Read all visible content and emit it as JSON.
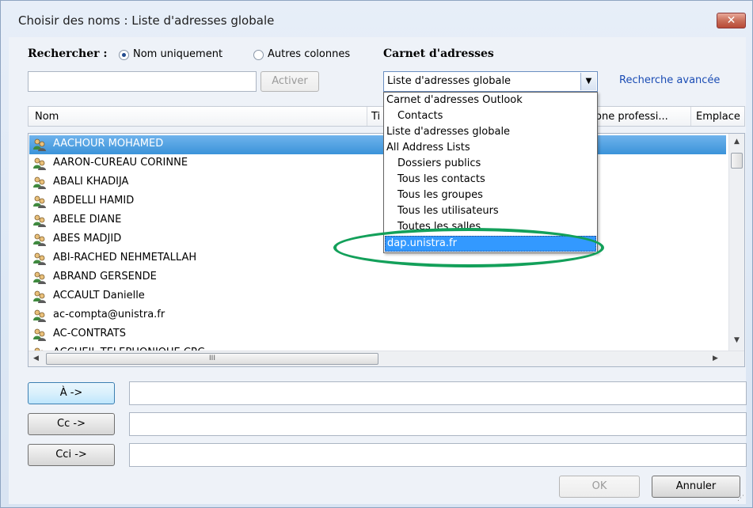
{
  "window": {
    "title": "Choisir des noms : Liste d'adresses globale",
    "close_glyph": "✕"
  },
  "search": {
    "label": "Rechercher :",
    "option_name_only": "Nom uniquement",
    "option_other_columns": "Autres colonnes",
    "selected_option": "Nom uniquement",
    "query_value": "",
    "go_button": "Activer"
  },
  "address_book": {
    "label": "Carnet d'adresses",
    "selected": "Liste d'adresses globale",
    "advanced_link": "Recherche avancée",
    "dropdown_items": [
      "Carnet d'adresses Outlook",
      "Contacts",
      "Liste d'adresses globale",
      "All Address Lists",
      "Dossiers publics",
      "Tous les contacts",
      "Tous les groupes",
      "Tous les utilisateurs",
      "Toutes les salles",
      "dap.unistra.fr"
    ],
    "highlighted_item": "dap.unistra.fr"
  },
  "list": {
    "columns": [
      "Nom",
      "Ti",
      "one professi...",
      "Emplace"
    ],
    "rows": [
      "AACHOUR MOHAMED",
      "AARON-CUREAU CORINNE",
      "ABALI KHADIJA",
      "ABDELLI HAMID",
      "ABELE DIANE",
      "ABES MADJID",
      "ABI-RACHED NEHMETALLAH",
      "ABRAND GERSENDE",
      "ACCAULT Danielle",
      "ac-compta@unistra.fr",
      "AC-CONTRATS",
      "ACCUEIL TELEPHONIQUE CRC"
    ],
    "selected_row": "AACHOUR MOHAMED",
    "hscroll_thumb_glyph": "III"
  },
  "recipients": {
    "to_button": "À ->",
    "cc_button": "Cc ->",
    "bcc_button": "Cci ->",
    "to_value": "",
    "cc_value": "",
    "bcc_value": ""
  },
  "footer": {
    "ok_button": "OK",
    "cancel_button": "Annuler"
  },
  "colors": {
    "selection": "#3b93d9",
    "dropdown_highlight": "#3399ff",
    "annotation_ellipse": "#13a05a",
    "link": "#1a4cb4"
  },
  "icons": {
    "row_icon": "person-contact-icon",
    "combo_arrow": "chevron-down-icon"
  }
}
